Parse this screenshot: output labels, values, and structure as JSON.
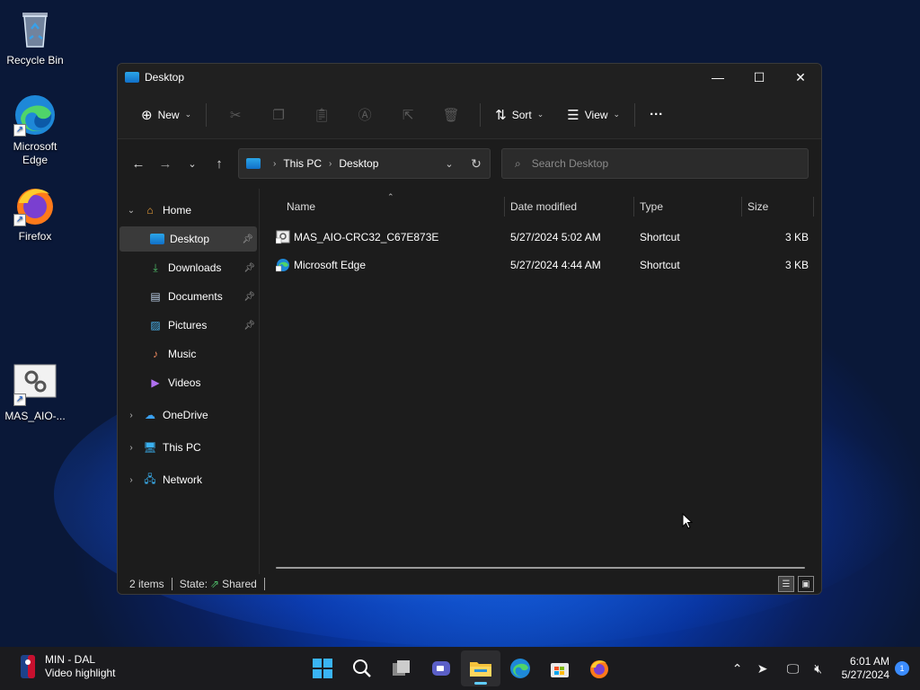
{
  "desktop": {
    "icons": [
      {
        "label": "Recycle Bin"
      },
      {
        "label": "Microsoft Edge"
      },
      {
        "label": "Firefox"
      },
      {
        "label": "MAS_AIO-..."
      }
    ]
  },
  "window": {
    "title": "Desktop",
    "cmdbar": {
      "new_label": "New",
      "sort_label": "Sort",
      "view_label": "View",
      "more_label": "···"
    },
    "address": {
      "crumbs": [
        "This PC",
        "Desktop"
      ]
    },
    "search": {
      "placeholder": "Search Desktop"
    },
    "nav": {
      "home": "Home",
      "desktop": "Desktop",
      "downloads": "Downloads",
      "documents": "Documents",
      "pictures": "Pictures",
      "music": "Music",
      "videos": "Videos",
      "onedrive": "OneDrive",
      "thispc": "This PC",
      "network": "Network"
    },
    "columns": {
      "name": "Name",
      "date": "Date modified",
      "type": "Type",
      "size": "Size"
    },
    "files": [
      {
        "name": "MAS_AIO-CRC32_C67E873E",
        "date": "5/27/2024 5:02 AM",
        "type": "Shortcut",
        "size": "3 KB"
      },
      {
        "name": "Microsoft Edge",
        "date": "5/27/2024 4:44 AM",
        "type": "Shortcut",
        "size": "3 KB"
      }
    ],
    "status": {
      "items": "2 items",
      "state_label": "State:",
      "state_value": "Shared"
    }
  },
  "taskbar": {
    "widget_title": "MIN - DAL",
    "widget_sub": "Video highlight",
    "time": "6:01 AM",
    "date": "5/27/2024",
    "notif_count": "1"
  }
}
